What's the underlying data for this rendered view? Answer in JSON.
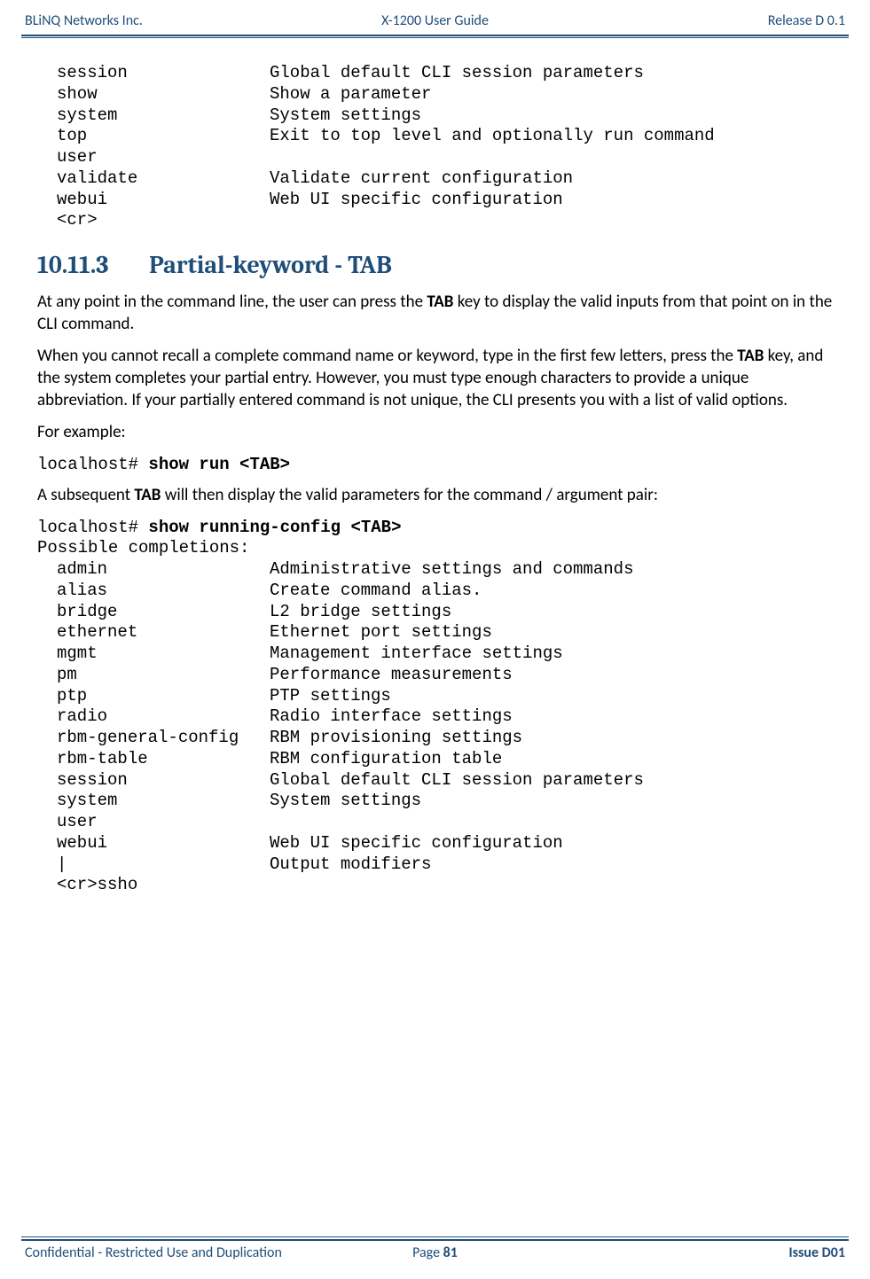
{
  "header": {
    "left": "BLiNQ Networks Inc.",
    "center": "X-1200 User Guide",
    "right": "Release D 0.1"
  },
  "cli_block_1": [
    {
      "key": "session",
      "desc": "Global default CLI session parameters"
    },
    {
      "key": "show",
      "desc": "Show a parameter"
    },
    {
      "key": "system",
      "desc": "System settings"
    },
    {
      "key": "top",
      "desc": "Exit to top level and optionally run command"
    },
    {
      "key": "user",
      "desc": ""
    },
    {
      "key": "validate",
      "desc": "Validate current configuration"
    },
    {
      "key": "webui",
      "desc": "Web UI specific configuration"
    },
    {
      "key": "<cr>",
      "desc": ""
    }
  ],
  "section": {
    "number": "10.11.3",
    "title": "Partial-keyword - TAB"
  },
  "para1a": "At any point in the command line, the user can press the ",
  "para1b": "TAB",
  "para1c": " key to display the valid inputs from that point on in the CLI command.",
  "para2a": "When you cannot recall a complete command name or keyword, type in the first few letters, press the ",
  "para2b": "TAB",
  "para2c": " key, and the system completes your partial entry. However, you must type enough characters to provide a unique abbreviation. If your partially entered command is not unique, the CLI presents you with a list of valid options.",
  "para3": "For example:",
  "cmd1_prompt": "localhost# ",
  "cmd1_cmd": "show run <TAB>",
  "para4a": "A subsequent ",
  "para4b": "TAB",
  "para4c": " will then display the valid parameters for the command / argument pair:",
  "cmd2_prompt": "localhost# ",
  "cmd2_cmd": "show running-config <TAB>",
  "cmd2_after": "Possible completions:",
  "cli_block_2": [
    {
      "key": "admin",
      "desc": "Administrative settings and commands"
    },
    {
      "key": "alias",
      "desc": "Create command alias."
    },
    {
      "key": "bridge",
      "desc": "L2 bridge settings"
    },
    {
      "key": "ethernet",
      "desc": "Ethernet port settings"
    },
    {
      "key": "mgmt",
      "desc": "Management interface settings"
    },
    {
      "key": "pm",
      "desc": "Performance measurements"
    },
    {
      "key": "ptp",
      "desc": "PTP settings"
    },
    {
      "key": "radio",
      "desc": "Radio interface settings"
    },
    {
      "key": "rbm-general-config",
      "desc": "RBM provisioning settings"
    },
    {
      "key": "rbm-table",
      "desc": "RBM configuration table"
    },
    {
      "key": "session",
      "desc": "Global default CLI session parameters"
    },
    {
      "key": "system",
      "desc": "System settings"
    },
    {
      "key": "user",
      "desc": ""
    },
    {
      "key": "webui",
      "desc": "Web UI specific configuration"
    },
    {
      "key": "|",
      "desc": "Output modifiers"
    },
    {
      "key": "<cr>ssho",
      "desc": ""
    }
  ],
  "footer": {
    "left": "Confidential - Restricted Use and Duplication",
    "center_pre": "Page ",
    "center_num": "81",
    "right": "Issue D01"
  }
}
